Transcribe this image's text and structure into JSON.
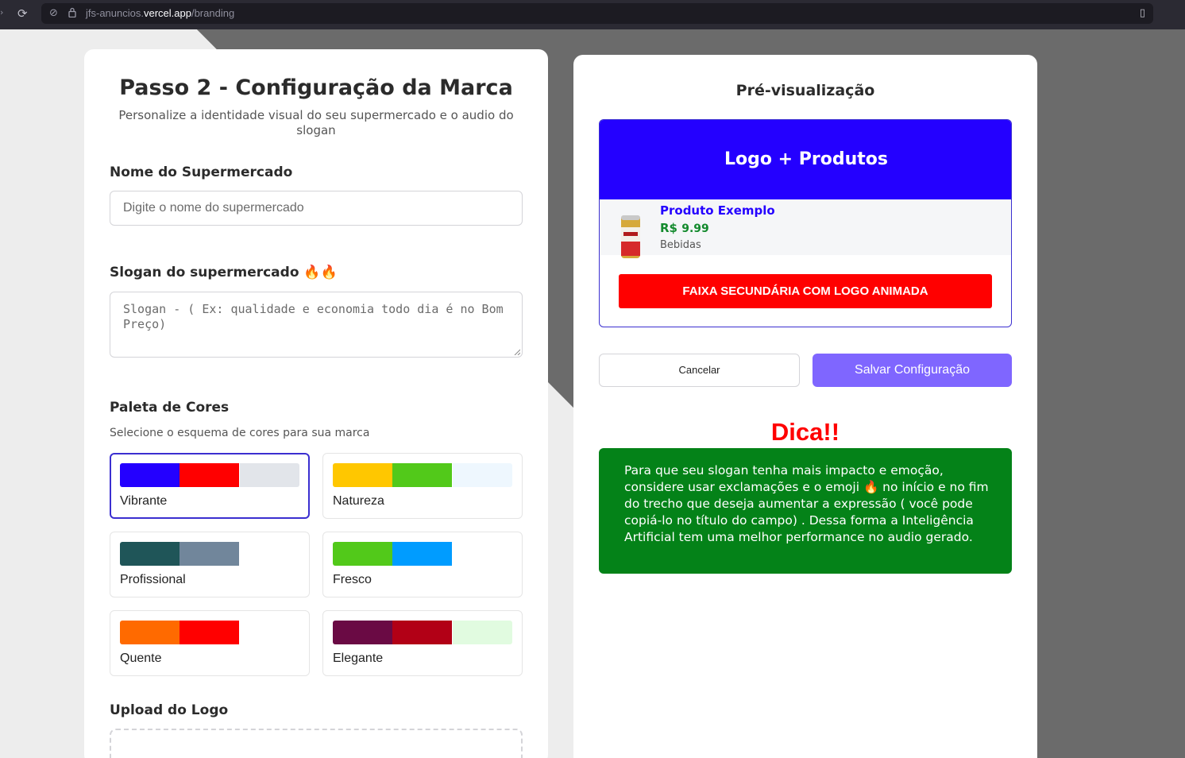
{
  "browser": {
    "url_prefix": "jfs-anuncios.",
    "url_domain": "vercel.app",
    "url_path": "/branding"
  },
  "form": {
    "title": "Passo 2 - Configuração da Marca",
    "subtitle": "Personalize a identidade visual do seu supermercado e o audio do slogan",
    "name_label": "Nome do Supermercado",
    "name_placeholder": "Digite o nome do supermercado",
    "slogan_label": "Slogan do supermercado 🔥🔥",
    "slogan_placeholder": "Slogan - ( Ex: qualidade e economia todo dia é no Bom Preço)",
    "palette_label": "Paleta de Cores",
    "palette_hint": "Selecione o esquema de cores para sua marca",
    "palettes": [
      {
        "name": "Vibrante",
        "colors": [
          "#2400ff",
          "#ff0000",
          "#e2e5ea"
        ],
        "selected": true
      },
      {
        "name": "Natureza",
        "colors": [
          "#ffc700",
          "#52c91a",
          "#eef7fe"
        ],
        "selected": false
      },
      {
        "name": "Profissional",
        "colors": [
          "#1f5558",
          "#71869b"
        ],
        "selected": false
      },
      {
        "name": "Fresco",
        "colors": [
          "#52c91a",
          "#009cff"
        ],
        "selected": false
      },
      {
        "name": "Quente",
        "colors": [
          "#ff6a00",
          "#ff0000"
        ],
        "selected": false
      },
      {
        "name": "Elegante",
        "colors": [
          "#6a0a44",
          "#b20016",
          "#e1fbe0"
        ],
        "selected": false
      }
    ],
    "upload_label": "Upload do Logo"
  },
  "preview": {
    "title": "Pré-visualização",
    "header_text": "Logo + Produtos",
    "product_name": "Produto Exemplo",
    "product_price_currency": "R$",
    "product_price": "9.99",
    "product_category": "Bebidas",
    "banner_text": "FAIXA SECUNDÁRIA COM LOGO ANIMADA"
  },
  "actions": {
    "cancel_label": "Cancelar",
    "save_label": "Salvar Configuração"
  },
  "tip": {
    "title": "Dica!!",
    "text": "Para que seu slogan tenha mais impacto e emoção, considere usar exclamações e o emoji 🔥 no início e no fim do trecho que deseja aumentar a expressão ( você pode copiá-lo no título do campo) . Dessa forma a Inteligência Artificial tem uma melhor performance no audio gerado."
  }
}
